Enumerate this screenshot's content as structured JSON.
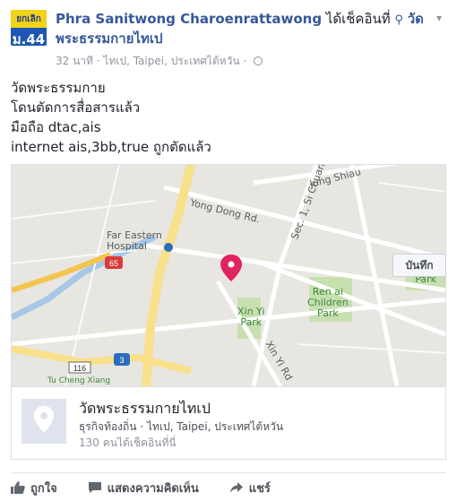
{
  "header": {
    "avatar_line1": "ยกเลิก",
    "avatar_line2": "ม.44",
    "page_name": "Phra Sanitwong Charoenrattawong",
    "checkin_text": " ได้เช็คอินที่ ",
    "place_name": "วัดพระธรรมกายไทเป",
    "time": "32 นาที",
    "location": "ไทเป, Taipei, ประเทศไต้หวัน",
    "separator": "·"
  },
  "post": {
    "lines": [
      "วัดพระธรรมกาย",
      "โดนตัดการสื่อสารแล้ว",
      "มือถือ dtac,ais",
      "internet ais,3bb,true ถูกตัดแล้ว"
    ]
  },
  "map": {
    "labels": {
      "street_jung_shiau": "Jung Shiau",
      "street_yong_dong": "Yong  Dong  Rd.",
      "street_si_chuan": "Sec. 1, Si Chuan",
      "hospital": "Far Eastern\nHospital",
      "park_hua_fu": "Hua Fu\nPark",
      "park_ren_ai": "Ren ai\nChildren\nPark",
      "park_xin_yi": "Xin Yi\nPark",
      "street_xin_yi": "Xin Yi Rd",
      "route_65": "65",
      "route_3": "3",
      "route_116": "116",
      "area_bottom": "Tu Cheng Xiang"
    },
    "colors": {
      "pin": "#e0245e",
      "road_major": "#f9e08a",
      "park": "#c8dfb0",
      "river": "#a7c7e7"
    }
  },
  "place_card": {
    "title": "วัดพระธรรมกายไทเป",
    "subtitle": "ธุรกิจท้องถิ่น · ไทเป, Taipei, ประเทศไต้หวัน",
    "count": "130 คนได้เช็คอินที่นี่",
    "save_label": "บันทึก"
  },
  "actions": {
    "like": "ถูกใจ",
    "comment": "แสดงความคิดเห็น",
    "share": "แชร์"
  }
}
